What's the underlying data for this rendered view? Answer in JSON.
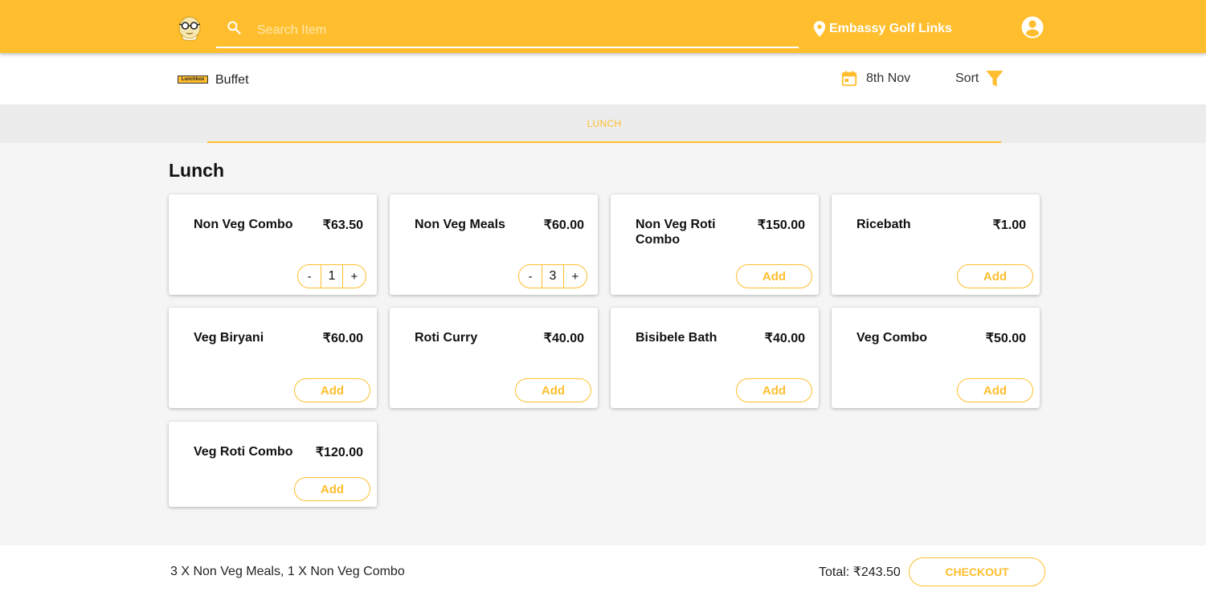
{
  "colors": {
    "accent": "#ffbe2e",
    "background": "#f5f5f5"
  },
  "header": {
    "logo_icon": "mascot-glasses-logo",
    "search": {
      "placeholder": "Search Item",
      "value": ""
    },
    "location": {
      "icon": "location-pin-icon",
      "label": "Embassy Golf Links"
    },
    "account_icon": "account-circle-icon"
  },
  "subheader": {
    "brand_logo_text": "Lunchbox",
    "brand_name": "Buffet",
    "date": {
      "icon": "calendar-icon",
      "label": "8th Nov"
    },
    "sort": {
      "label": "Sort",
      "icon": "filter-icon"
    }
  },
  "tabs": [
    {
      "label": "LUNCH",
      "active": true
    }
  ],
  "section": {
    "title": "Lunch"
  },
  "menu_items": [
    {
      "name": "Non Veg Combo",
      "price": "₹63.50",
      "quantity": "1",
      "in_cart": true
    },
    {
      "name": "Non Veg Meals",
      "price": "₹60.00",
      "quantity": "3",
      "in_cart": true
    },
    {
      "name": "Non Veg Roti Combo",
      "price": "₹150.00",
      "add_label": "Add",
      "in_cart": false
    },
    {
      "name": "Ricebath",
      "price": "₹1.00",
      "add_label": "Add",
      "in_cart": false
    },
    {
      "name": "Veg Biryani",
      "price": "₹60.00",
      "add_label": "Add",
      "in_cart": false
    },
    {
      "name": "Roti Curry",
      "price": "₹40.00",
      "add_label": "Add",
      "in_cart": false
    },
    {
      "name": "Bisibele Bath",
      "price": "₹40.00",
      "add_label": "Add",
      "in_cart": false
    },
    {
      "name": "Veg Combo",
      "price": "₹50.00",
      "add_label": "Add",
      "in_cart": false
    },
    {
      "name": "Veg Roti Combo",
      "price": "₹120.00",
      "add_label": "Add",
      "in_cart": false
    }
  ],
  "stepper": {
    "minus": "-",
    "plus": "+"
  },
  "footer": {
    "order_summary": "3 X Non Veg Meals, 1 X Non Veg Combo",
    "total": "Total: ₹243.50",
    "checkout_label": "CHECKOUT"
  }
}
